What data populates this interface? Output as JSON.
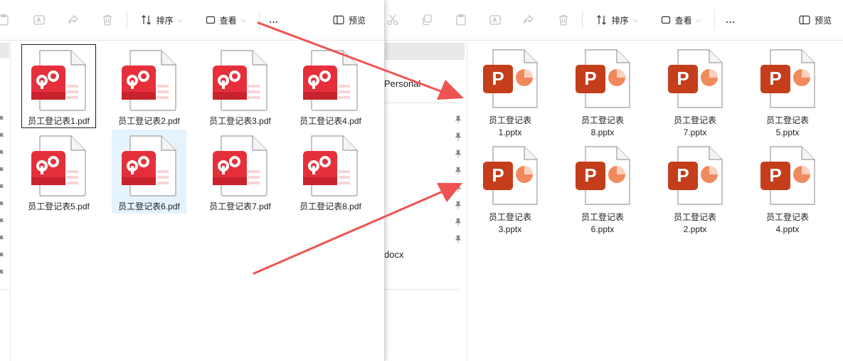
{
  "left_window": {
    "toolbar": {
      "sort_label": "排序",
      "view_label": "查看",
      "more_label": "...",
      "preview_label": "预览"
    },
    "files": [
      {
        "name": "员工登记表1.pdf"
      },
      {
        "name": "员工登记表2.pdf"
      },
      {
        "name": "员工登记表3.pdf"
      },
      {
        "name": "员工登记表4.pdf"
      },
      {
        "name": "员工登记表5.pdf"
      },
      {
        "name": "员工登记表6.pdf"
      },
      {
        "name": "员工登记表7.pdf"
      },
      {
        "name": "员工登记表8.pdf"
      }
    ]
  },
  "right_window": {
    "toolbar": {
      "sort_label": "排序",
      "view_label": "查看",
      "more_label": "...",
      "preview_label": "预览"
    },
    "nav": {
      "personal_label": "Personal",
      "docx_label": "docx"
    },
    "files": [
      {
        "line1": "员工登记表",
        "line2": "1.pptx"
      },
      {
        "line1": "员工登记表",
        "line2": "8.pptx"
      },
      {
        "line1": "员工登记表",
        "line2": "7.pptx"
      },
      {
        "line1": "员工登记表",
        "line2": "5.pptx"
      },
      {
        "line1": "员工登记表",
        "line2": "3.pptx"
      },
      {
        "line1": "员工登记表",
        "line2": "6.pptx"
      },
      {
        "line1": "员工登记表",
        "line2": "2.pptx"
      },
      {
        "line1": "员工登记表",
        "line2": "4.pptx"
      }
    ]
  },
  "colors": {
    "pdf_red": "#e5303c",
    "ppt_orange": "#c43e1c",
    "arrow": "#ef5350",
    "selection": "#e5f3ff"
  }
}
